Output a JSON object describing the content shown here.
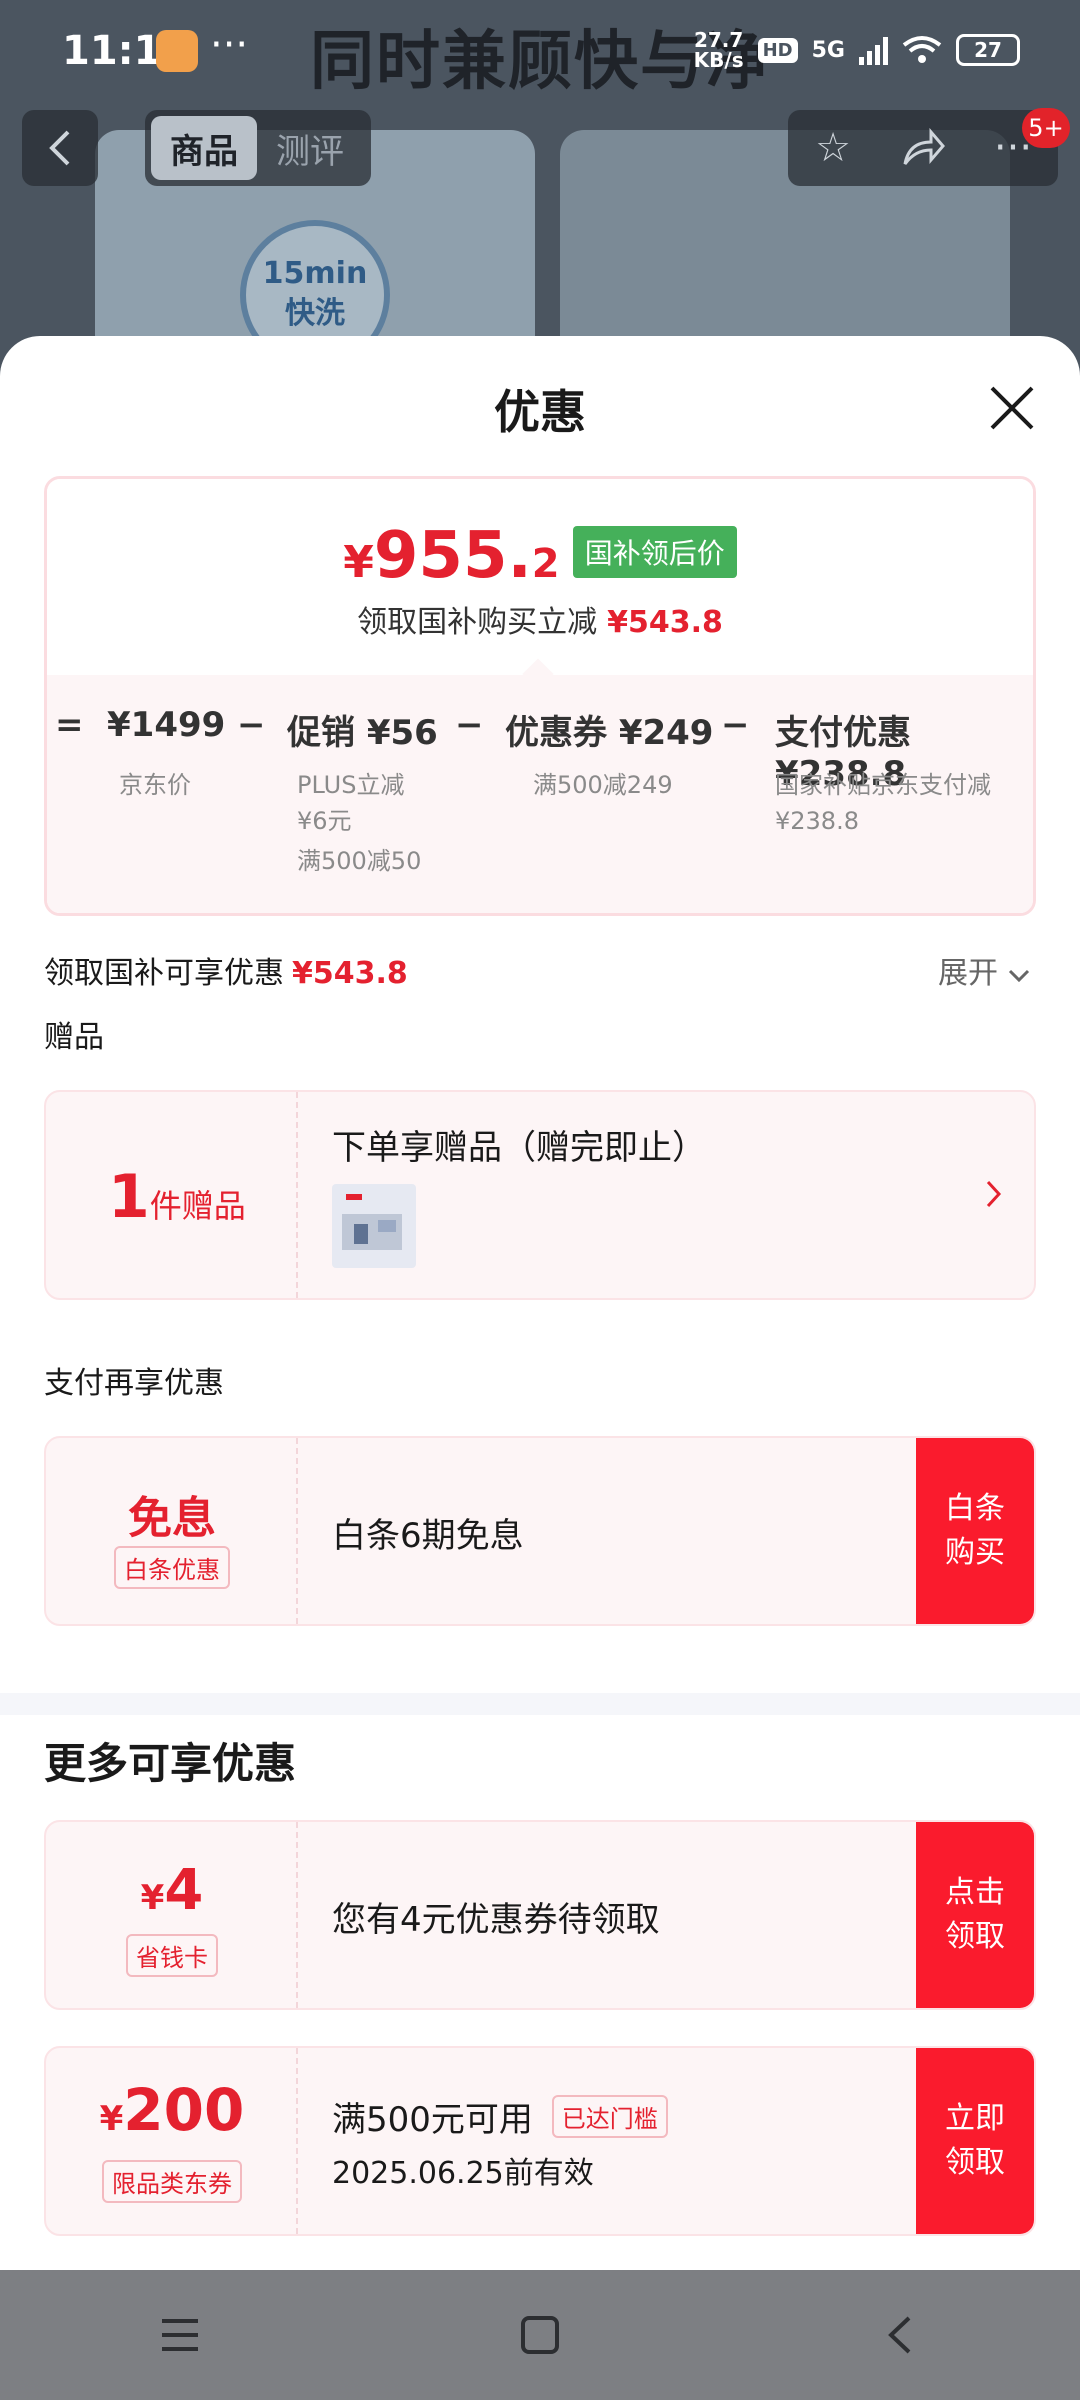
{
  "status_bar": {
    "time": "11:17",
    "net_speed_value": "27.7",
    "net_speed_unit": "KB/s",
    "hd": "HD",
    "network": "5G",
    "battery": "27"
  },
  "background": {
    "banner_text": "同时兼顾快与净",
    "badge_line1": "15min",
    "badge_line2": "快洗"
  },
  "top_nav": {
    "tabs": [
      {
        "label": "商品"
      },
      {
        "label": "测评"
      }
    ],
    "message_badge": "5+"
  },
  "sheet": {
    "title": "优惠",
    "price": {
      "currency": "¥",
      "integer": "955.",
      "decimal": "2",
      "tag": "国补领后价",
      "subtitle": "领取国补购买立减",
      "subtitle_amount": "¥543.8"
    },
    "formula": {
      "eq": "=",
      "minus": "−",
      "items": [
        {
          "label": "¥1499",
          "notes": [
            "京东价"
          ]
        },
        {
          "label": "促销 ¥56",
          "notes": [
            "PLUS立减",
            "¥6元",
            "满500减50"
          ]
        },
        {
          "label": "优惠券 ¥249",
          "notes": [
            "满500减249"
          ]
        },
        {
          "label": "支付优惠 ¥238.8",
          "notes": [
            "国家补贴京东支付减",
            "¥238.8"
          ]
        }
      ]
    },
    "subsidy_row": {
      "label": "领取国补可享优惠",
      "amount": "¥543.8",
      "expand": "展开"
    },
    "gift_section": {
      "label": "赠品",
      "count": "1",
      "count_unit": "件赠品",
      "title": "下单享赠品（赠完即止）"
    },
    "pay_section": {
      "label": "支付再享优惠",
      "big": "免息",
      "pill": "白条优惠",
      "text": "白条6期免息",
      "button": "白条购买"
    },
    "more_section": {
      "title": "更多可享优惠",
      "offers": [
        {
          "currency": "¥",
          "amount": "4",
          "pill": "省钱卡",
          "line1": "您有4元优惠券待领取",
          "line2": "",
          "badge": "",
          "button": "点击领取"
        },
        {
          "currency": "¥",
          "amount": "200",
          "pill": "限品类东券",
          "line1": "满500元可用",
          "line2": "2025.06.25前有效",
          "badge": "已达门槛",
          "button": "立即领取"
        }
      ]
    }
  },
  "colors": {
    "accent_red": "#e4212f",
    "button_red": "#fa1b2d",
    "green_tag": "#45b05a",
    "card_bg": "#fdf5f6"
  }
}
